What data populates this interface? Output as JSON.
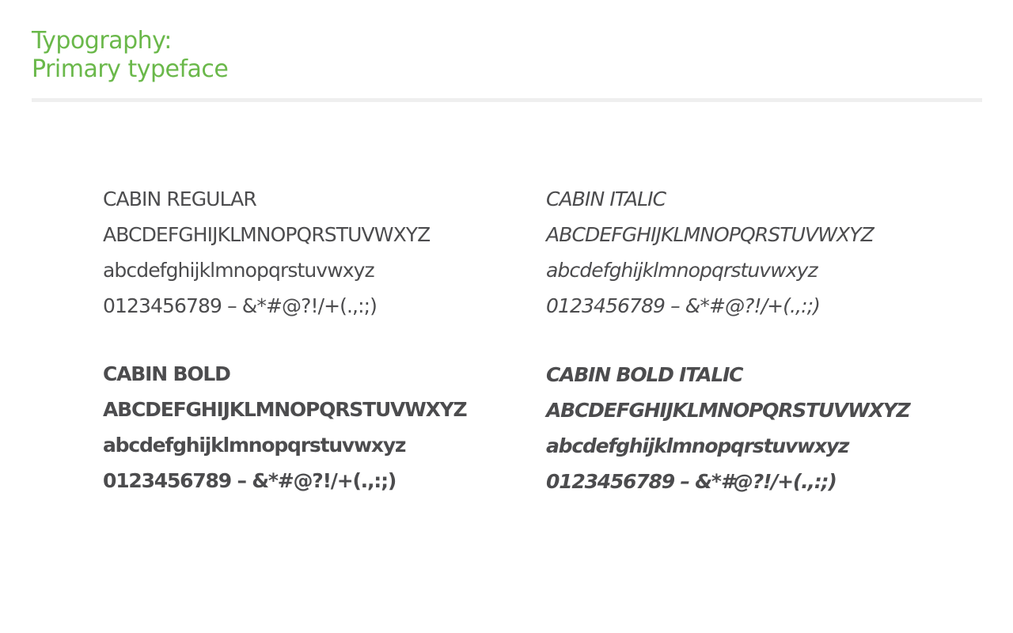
{
  "header": {
    "title_line1": "Typography:",
    "title_line2": "Primary typeface"
  },
  "colors": {
    "accent": "#6ab84a",
    "text": "#4c4c4e",
    "divider": "#efefef"
  },
  "specimens": {
    "regular": {
      "name": "CABIN REGULAR",
      "uppercase": "ABCDEFGHIJKLMNOPQRSTUVWXYZ",
      "lowercase": "abcdefghijklmnopqrstuvwxyz",
      "numerals": "0123456789 – &*#@?!/+(.,:;)"
    },
    "italic": {
      "name": "CABIN ITALIC",
      "uppercase": "ABCDEFGHIJKLMNOPQRSTUVWXYZ",
      "lowercase": "abcdefghijklmnopqrstuvwxyz",
      "numerals": "0123456789 – &*#@?!/+(.,:;)"
    },
    "bold": {
      "name": "CABIN BOLD",
      "uppercase": "ABCDEFGHIJKLMNOPQRSTUVWXYZ",
      "lowercase": "abcdefghijklmnopqrstuvwxyz",
      "numerals": "0123456789 – &*#@?!/+(.,:;)"
    },
    "bold_italic": {
      "name": "CABIN BOLD ITALIC",
      "uppercase": "ABCDEFGHIJKLMNOPQRSTUVWXYZ",
      "lowercase": "abcdefghijklmnopqrstuvwxyz",
      "numerals": "0123456789 – &*#@?!/+(.,:;)"
    }
  }
}
